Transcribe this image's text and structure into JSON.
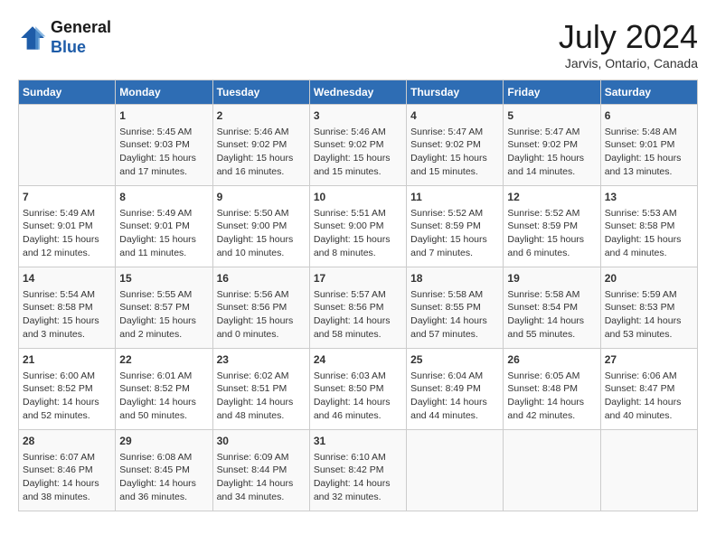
{
  "header": {
    "logo_line1": "General",
    "logo_line2": "Blue",
    "month_year": "July 2024",
    "location": "Jarvis, Ontario, Canada"
  },
  "days_of_week": [
    "Sunday",
    "Monday",
    "Tuesday",
    "Wednesday",
    "Thursday",
    "Friday",
    "Saturday"
  ],
  "weeks": [
    [
      {
        "day": "",
        "info": ""
      },
      {
        "day": "1",
        "info": "Sunrise: 5:45 AM\nSunset: 9:03 PM\nDaylight: 15 hours\nand 17 minutes."
      },
      {
        "day": "2",
        "info": "Sunrise: 5:46 AM\nSunset: 9:02 PM\nDaylight: 15 hours\nand 16 minutes."
      },
      {
        "day": "3",
        "info": "Sunrise: 5:46 AM\nSunset: 9:02 PM\nDaylight: 15 hours\nand 15 minutes."
      },
      {
        "day": "4",
        "info": "Sunrise: 5:47 AM\nSunset: 9:02 PM\nDaylight: 15 hours\nand 15 minutes."
      },
      {
        "day": "5",
        "info": "Sunrise: 5:47 AM\nSunset: 9:02 PM\nDaylight: 15 hours\nand 14 minutes."
      },
      {
        "day": "6",
        "info": "Sunrise: 5:48 AM\nSunset: 9:01 PM\nDaylight: 15 hours\nand 13 minutes."
      }
    ],
    [
      {
        "day": "7",
        "info": "Sunrise: 5:49 AM\nSunset: 9:01 PM\nDaylight: 15 hours\nand 12 minutes."
      },
      {
        "day": "8",
        "info": "Sunrise: 5:49 AM\nSunset: 9:01 PM\nDaylight: 15 hours\nand 11 minutes."
      },
      {
        "day": "9",
        "info": "Sunrise: 5:50 AM\nSunset: 9:00 PM\nDaylight: 15 hours\nand 10 minutes."
      },
      {
        "day": "10",
        "info": "Sunrise: 5:51 AM\nSunset: 9:00 PM\nDaylight: 15 hours\nand 8 minutes."
      },
      {
        "day": "11",
        "info": "Sunrise: 5:52 AM\nSunset: 8:59 PM\nDaylight: 15 hours\nand 7 minutes."
      },
      {
        "day": "12",
        "info": "Sunrise: 5:52 AM\nSunset: 8:59 PM\nDaylight: 15 hours\nand 6 minutes."
      },
      {
        "day": "13",
        "info": "Sunrise: 5:53 AM\nSunset: 8:58 PM\nDaylight: 15 hours\nand 4 minutes."
      }
    ],
    [
      {
        "day": "14",
        "info": "Sunrise: 5:54 AM\nSunset: 8:58 PM\nDaylight: 15 hours\nand 3 minutes."
      },
      {
        "day": "15",
        "info": "Sunrise: 5:55 AM\nSunset: 8:57 PM\nDaylight: 15 hours\nand 2 minutes."
      },
      {
        "day": "16",
        "info": "Sunrise: 5:56 AM\nSunset: 8:56 PM\nDaylight: 15 hours\nand 0 minutes."
      },
      {
        "day": "17",
        "info": "Sunrise: 5:57 AM\nSunset: 8:56 PM\nDaylight: 14 hours\nand 58 minutes."
      },
      {
        "day": "18",
        "info": "Sunrise: 5:58 AM\nSunset: 8:55 PM\nDaylight: 14 hours\nand 57 minutes."
      },
      {
        "day": "19",
        "info": "Sunrise: 5:58 AM\nSunset: 8:54 PM\nDaylight: 14 hours\nand 55 minutes."
      },
      {
        "day": "20",
        "info": "Sunrise: 5:59 AM\nSunset: 8:53 PM\nDaylight: 14 hours\nand 53 minutes."
      }
    ],
    [
      {
        "day": "21",
        "info": "Sunrise: 6:00 AM\nSunset: 8:52 PM\nDaylight: 14 hours\nand 52 minutes."
      },
      {
        "day": "22",
        "info": "Sunrise: 6:01 AM\nSunset: 8:52 PM\nDaylight: 14 hours\nand 50 minutes."
      },
      {
        "day": "23",
        "info": "Sunrise: 6:02 AM\nSunset: 8:51 PM\nDaylight: 14 hours\nand 48 minutes."
      },
      {
        "day": "24",
        "info": "Sunrise: 6:03 AM\nSunset: 8:50 PM\nDaylight: 14 hours\nand 46 minutes."
      },
      {
        "day": "25",
        "info": "Sunrise: 6:04 AM\nSunset: 8:49 PM\nDaylight: 14 hours\nand 44 minutes."
      },
      {
        "day": "26",
        "info": "Sunrise: 6:05 AM\nSunset: 8:48 PM\nDaylight: 14 hours\nand 42 minutes."
      },
      {
        "day": "27",
        "info": "Sunrise: 6:06 AM\nSunset: 8:47 PM\nDaylight: 14 hours\nand 40 minutes."
      }
    ],
    [
      {
        "day": "28",
        "info": "Sunrise: 6:07 AM\nSunset: 8:46 PM\nDaylight: 14 hours\nand 38 minutes."
      },
      {
        "day": "29",
        "info": "Sunrise: 6:08 AM\nSunset: 8:45 PM\nDaylight: 14 hours\nand 36 minutes."
      },
      {
        "day": "30",
        "info": "Sunrise: 6:09 AM\nSunset: 8:44 PM\nDaylight: 14 hours\nand 34 minutes."
      },
      {
        "day": "31",
        "info": "Sunrise: 6:10 AM\nSunset: 8:42 PM\nDaylight: 14 hours\nand 32 minutes."
      },
      {
        "day": "",
        "info": ""
      },
      {
        "day": "",
        "info": ""
      },
      {
        "day": "",
        "info": ""
      }
    ]
  ]
}
